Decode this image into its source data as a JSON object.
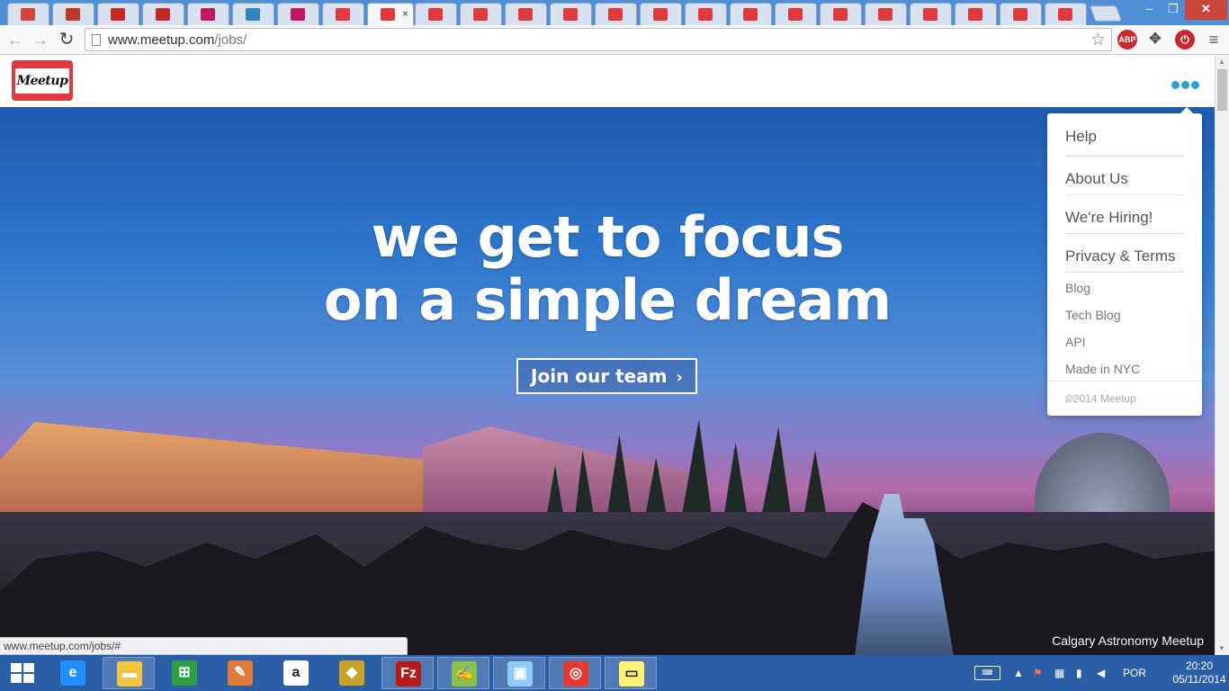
{
  "browser": {
    "tabs": [
      {
        "icon": "gmail-icon",
        "color": "#d44638"
      },
      {
        "icon": "gmail-icon",
        "color": "#c0392b"
      },
      {
        "icon": "opera-icon",
        "color": "#c62828"
      },
      {
        "icon": "opera-icon",
        "color": "#c62828"
      },
      {
        "icon": "b-icon",
        "color": "#c2185b"
      },
      {
        "icon": "globe-icon",
        "color": "#2e86c1"
      },
      {
        "icon": "b-icon",
        "color": "#c2185b"
      },
      {
        "icon": "meetup-icon",
        "color": "#e0393e"
      },
      {
        "icon": "meetup-icon",
        "color": "#e0393e",
        "active": true
      },
      {
        "icon": "meetup-icon",
        "color": "#e0393e"
      },
      {
        "icon": "meetup-icon",
        "color": "#e0393e"
      },
      {
        "icon": "meetup-icon",
        "color": "#e0393e"
      },
      {
        "icon": "meetup-icon",
        "color": "#e0393e"
      },
      {
        "icon": "meetup-icon",
        "color": "#e0393e"
      },
      {
        "icon": "meetup-icon",
        "color": "#e0393e"
      },
      {
        "icon": "meetup-icon",
        "color": "#e0393e"
      },
      {
        "icon": "meetup-icon",
        "color": "#e0393e"
      },
      {
        "icon": "meetup-icon",
        "color": "#e0393e"
      },
      {
        "icon": "meetup-icon",
        "color": "#e0393e"
      },
      {
        "icon": "meetup-icon",
        "color": "#e0393e"
      },
      {
        "icon": "meetup-icon",
        "color": "#e0393e"
      },
      {
        "icon": "meetup-icon",
        "color": "#e0393e"
      },
      {
        "icon": "meetup-icon",
        "color": "#e0393e"
      },
      {
        "icon": "meetup-icon",
        "color": "#e0393e"
      }
    ],
    "active_tab_close": "×",
    "window_controls": {
      "minimize": "‒",
      "maximize": "❐",
      "close": "✕"
    },
    "url_host": "www.meetup.com",
    "url_path": "/jobs/",
    "extensions": {
      "abp": "ABP"
    },
    "status_url": "www.meetup.com/jobs/#"
  },
  "site": {
    "logo_text": "Meetup",
    "hero": {
      "headline_line1": "we get to focus",
      "headline_line2": "on a simple dream",
      "cta_label": "Join our team",
      "caption": "Calgary Astronomy Meetup"
    },
    "menu": {
      "primary": [
        "Help",
        "About Us",
        "We're Hiring!",
        "Privacy & Terms"
      ],
      "secondary": [
        "Blog",
        "Tech Blog",
        "API",
        "Made in NYC"
      ],
      "copyright": "©2014 Meetup"
    },
    "accent_color": "#2a9fd8",
    "brand_color": "#e0393e"
  },
  "taskbar": {
    "apps": [
      {
        "icon": "internet-explorer-icon",
        "open": false
      },
      {
        "icon": "file-explorer-icon",
        "open": true
      },
      {
        "icon": "windows-store-icon",
        "open": false
      },
      {
        "icon": "paint-icon",
        "open": false
      },
      {
        "icon": "amazon-icon",
        "open": false
      },
      {
        "icon": "media-icon",
        "open": false
      },
      {
        "icon": "filezilla-icon",
        "open": true
      },
      {
        "icon": "notepad-icon",
        "open": true
      },
      {
        "icon": "virtualbox-icon",
        "open": true
      },
      {
        "icon": "chrome-icon",
        "open": true
      },
      {
        "icon": "sticky-notes-icon",
        "open": true
      }
    ],
    "language": "POR",
    "time": "20:20",
    "date": "05/11/2014"
  }
}
